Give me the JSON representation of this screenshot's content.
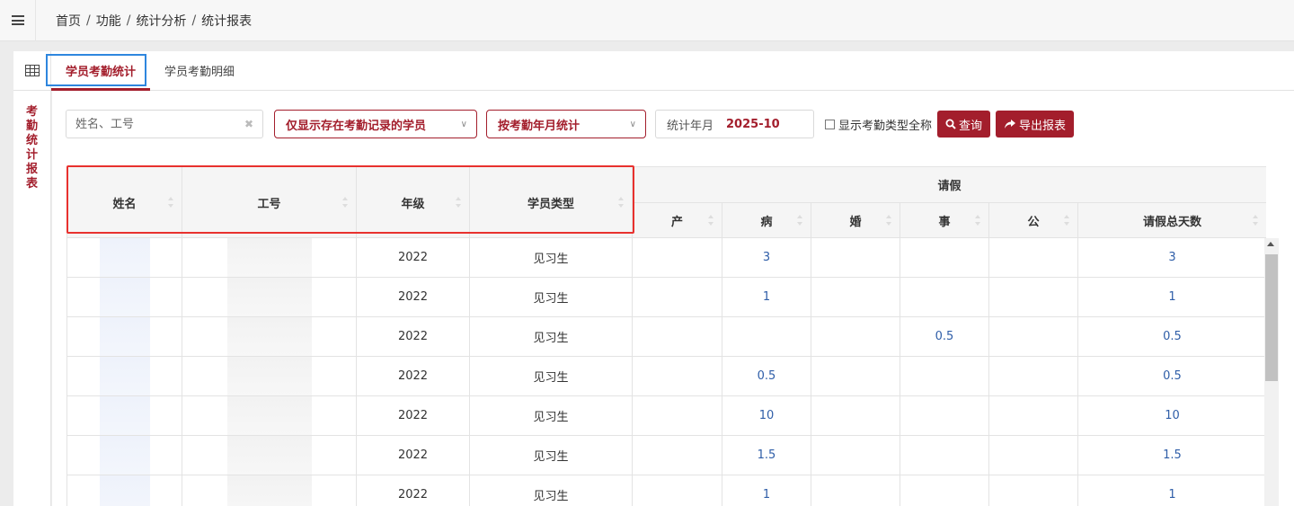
{
  "breadcrumb": [
    "首页",
    "功能",
    "统计分析",
    "统计报表"
  ],
  "tabs": [
    {
      "label": "学员考勤统计",
      "active": true
    },
    {
      "label": "学员考勤明细",
      "active": false
    }
  ],
  "side_title": "考勤统计报表",
  "filters": {
    "search_placeholder": "姓名、工号",
    "record_filter": "仅显示存在考勤记录的学员",
    "stat_mode": "按考勤年月统计",
    "period_label": "统计年月",
    "period_value": "2025-10",
    "show_fullname_label": "显示考勤类型全称",
    "query_label": "查询",
    "export_label": "导出报表"
  },
  "table": {
    "columns": {
      "name": "姓名",
      "id": "工号",
      "grade": "年级",
      "type": "学员类型",
      "leave_group": "请假",
      "maternity": "产",
      "sick": "病",
      "marriage": "婚",
      "personal": "事",
      "official": "公",
      "total": "请假总天数"
    },
    "rows": [
      {
        "grade": "2022",
        "type": "见习生",
        "maternity": "",
        "sick": "3",
        "marriage": "",
        "personal": "",
        "official": "",
        "total": "3"
      },
      {
        "grade": "2022",
        "type": "见习生",
        "maternity": "",
        "sick": "1",
        "marriage": "",
        "personal": "",
        "official": "",
        "total": "1"
      },
      {
        "grade": "2022",
        "type": "见习生",
        "maternity": "",
        "sick": "",
        "marriage": "",
        "personal": "0.5",
        "official": "",
        "total": "0.5"
      },
      {
        "grade": "2022",
        "type": "见习生",
        "maternity": "",
        "sick": "0.5",
        "marriage": "",
        "personal": "",
        "official": "",
        "total": "0.5"
      },
      {
        "grade": "2022",
        "type": "见习生",
        "maternity": "",
        "sick": "10",
        "marriage": "",
        "personal": "",
        "official": "",
        "total": "10"
      },
      {
        "grade": "2022",
        "type": "见习生",
        "maternity": "",
        "sick": "1.5",
        "marriage": "",
        "personal": "",
        "official": "",
        "total": "1.5"
      },
      {
        "grade": "2022",
        "type": "见习生",
        "maternity": "",
        "sick": "1",
        "marriage": "",
        "personal": "",
        "official": "",
        "total": "1"
      }
    ]
  },
  "colors": {
    "accent": "#a31e2c",
    "link": "#2f5ea8",
    "highlight_red": "#e8312e",
    "highlight_blue": "#2e86de"
  }
}
